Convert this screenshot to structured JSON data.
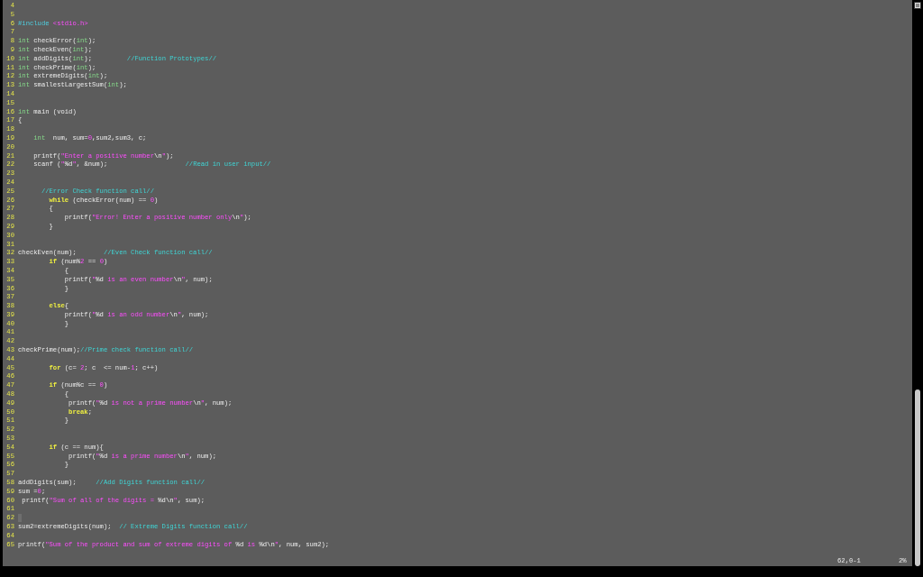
{
  "editor": {
    "lines": [
      {
        "number": "4"
      },
      {
        "number": "5"
      },
      {
        "number": "6",
        "tokens": [
          {
            "kind": "preproc",
            "text": "#include"
          },
          {
            "kind": "string",
            "text": " <stdio.h>"
          }
        ]
      },
      {
        "number": "7"
      },
      {
        "number": "8",
        "tokens": [
          {
            "kind": "type",
            "text": "int"
          },
          " checkError(",
          {
            "kind": "type",
            "text": "int"
          },
          ");"
        ]
      },
      {
        "number": "9",
        "tokens": [
          {
            "kind": "type",
            "text": "int"
          },
          " checkEven(",
          {
            "kind": "type",
            "text": "int"
          },
          ");"
        ]
      },
      {
        "number": "10",
        "tokens": [
          {
            "kind": "type",
            "text": "int"
          },
          " addDigits(",
          {
            "kind": "type",
            "text": "int"
          },
          ");         ",
          {
            "kind": "comment",
            "text": "//Function Prototypes//"
          }
        ]
      },
      {
        "number": "11",
        "tokens": [
          {
            "kind": "type",
            "text": "int"
          },
          " checkPrime(",
          {
            "kind": "type",
            "text": "int"
          },
          ");"
        ]
      },
      {
        "number": "12",
        "tokens": [
          {
            "kind": "type",
            "text": "int"
          },
          " extremeDigits(",
          {
            "kind": "type",
            "text": "int"
          },
          ");"
        ]
      },
      {
        "number": "13",
        "tokens": [
          {
            "kind": "type",
            "text": "int"
          },
          " smallestLargestSum(",
          {
            "kind": "type",
            "text": "int"
          },
          ");"
        ]
      },
      {
        "number": "14"
      },
      {
        "number": "15"
      },
      {
        "number": "16",
        "tokens": [
          {
            "kind": "type",
            "text": "int"
          },
          " main (void)"
        ]
      },
      {
        "number": "17",
        "tokens": [
          "{"
        ]
      },
      {
        "number": "18"
      },
      {
        "number": "19",
        "tokens": [
          {
            "kind": "type",
            "text": "    int"
          },
          "  num, sum=",
          {
            "kind": "number",
            "text": "0"
          },
          ",sum2,sum3, c;"
        ]
      },
      {
        "number": "20"
      },
      {
        "number": "21",
        "tokens": [
          "    printf(",
          {
            "kind": "string",
            "text": "\"Enter a positive number"
          },
          {
            "kind": "special",
            "text": "\\n"
          },
          {
            "kind": "string",
            "text": "\""
          },
          ");"
        ]
      },
      {
        "number": "22",
        "tokens": [
          "    scanf (",
          {
            "kind": "string",
            "text": "\""
          },
          {
            "kind": "special",
            "text": "%d"
          },
          {
            "kind": "string",
            "text": "\""
          },
          ", &num);                    ",
          {
            "kind": "comment",
            "text": "//Read in user input//"
          }
        ]
      },
      {
        "number": "23"
      },
      {
        "number": "24"
      },
      {
        "number": "25",
        "tokens": [
          {
            "kind": "comment",
            "text": "      //Error Check function call//"
          }
        ]
      },
      {
        "number": "26",
        "tokens": [
          {
            "kind": "keyword",
            "text": "        while"
          },
          " (checkError(num) == ",
          {
            "kind": "number",
            "text": "0"
          },
          ")"
        ]
      },
      {
        "number": "27",
        "tokens": [
          "        {"
        ]
      },
      {
        "number": "28",
        "tokens": [
          "            printf(",
          {
            "kind": "string",
            "text": "\"Error! Enter a positive number only"
          },
          {
            "kind": "special",
            "text": "\\n"
          },
          {
            "kind": "string",
            "text": "\""
          },
          ");"
        ]
      },
      {
        "number": "29",
        "tokens": [
          "        }"
        ]
      },
      {
        "number": "30"
      },
      {
        "number": "31"
      },
      {
        "number": "32",
        "tokens": [
          "checkEven(num);       ",
          {
            "kind": "comment",
            "text": "//Even Check function call//"
          }
        ]
      },
      {
        "number": "33",
        "tokens": [
          {
            "kind": "keyword",
            "text": "        if"
          },
          " (num%",
          {
            "kind": "number",
            "text": "2"
          },
          " == ",
          {
            "kind": "number",
            "text": "0"
          },
          ")"
        ]
      },
      {
        "number": "34",
        "tokens": [
          "            {"
        ]
      },
      {
        "number": "35",
        "tokens": [
          "            printf(",
          {
            "kind": "string",
            "text": "\""
          },
          {
            "kind": "special",
            "text": "%d"
          },
          {
            "kind": "string",
            "text": " is an even number"
          },
          {
            "kind": "special",
            "text": "\\n"
          },
          {
            "kind": "string",
            "text": "\""
          },
          ", num);"
        ]
      },
      {
        "number": "36",
        "tokens": [
          "            }"
        ]
      },
      {
        "number": "37"
      },
      {
        "number": "38",
        "tokens": [
          {
            "kind": "keyword",
            "text": "        else"
          },
          "{"
        ]
      },
      {
        "number": "39",
        "tokens": [
          "            printf(",
          {
            "kind": "string",
            "text": "\""
          },
          {
            "kind": "special",
            "text": "%d"
          },
          {
            "kind": "string",
            "text": " is an odd number"
          },
          {
            "kind": "special",
            "text": "\\n"
          },
          {
            "kind": "string",
            "text": "\""
          },
          ", num);"
        ]
      },
      {
        "number": "40",
        "tokens": [
          "            }"
        ]
      },
      {
        "number": "41"
      },
      {
        "number": "42"
      },
      {
        "number": "43",
        "tokens": [
          "checkPrime(num);",
          {
            "kind": "comment",
            "text": "//Prime check function call//"
          }
        ]
      },
      {
        "number": "44"
      },
      {
        "number": "45",
        "tokens": [
          {
            "kind": "keyword",
            "text": "        for"
          },
          " (c= ",
          {
            "kind": "number",
            "text": "2"
          },
          "; c  <= num-",
          {
            "kind": "number",
            "text": "1"
          },
          "; c++)"
        ]
      },
      {
        "number": "46"
      },
      {
        "number": "47",
        "tokens": [
          {
            "kind": "keyword",
            "text": "        if"
          },
          " (num%c == ",
          {
            "kind": "number",
            "text": "0"
          },
          ")"
        ]
      },
      {
        "number": "48",
        "tokens": [
          "            {"
        ]
      },
      {
        "number": "49",
        "tokens": [
          "             printf(",
          {
            "kind": "string",
            "text": "\""
          },
          {
            "kind": "special",
            "text": "%d"
          },
          {
            "kind": "string",
            "text": " is not a prime number"
          },
          {
            "kind": "special",
            "text": "\\n"
          },
          {
            "kind": "string",
            "text": "\""
          },
          ", num);"
        ]
      },
      {
        "number": "50",
        "tokens": [
          {
            "kind": "keyword",
            "text": "             break"
          },
          ";"
        ]
      },
      {
        "number": "51",
        "tokens": [
          "            }"
        ]
      },
      {
        "number": "52"
      },
      {
        "number": "53"
      },
      {
        "number": "54",
        "tokens": [
          {
            "kind": "keyword",
            "text": "        if"
          },
          " (c == num){"
        ]
      },
      {
        "number": "55",
        "tokens": [
          "             printf(",
          {
            "kind": "string",
            "text": "\""
          },
          {
            "kind": "special",
            "text": "%d"
          },
          {
            "kind": "string",
            "text": " is a prime number"
          },
          {
            "kind": "special",
            "text": "\\n"
          },
          {
            "kind": "string",
            "text": "\""
          },
          ", num);"
        ]
      },
      {
        "number": "56",
        "tokens": [
          "            }"
        ]
      },
      {
        "number": "57"
      },
      {
        "number": "58",
        "tokens": [
          "addDigits(sum);     ",
          {
            "kind": "comment",
            "text": "//Add Digits function call//"
          }
        ]
      },
      {
        "number": "59",
        "tokens": [
          "sum =",
          {
            "kind": "number",
            "text": "0"
          },
          ";"
        ]
      },
      {
        "number": "60",
        "tokens": [
          " printf(",
          {
            "kind": "string",
            "text": "\"Sum of all of the digits = "
          },
          {
            "kind": "special",
            "text": "%d\\n"
          },
          {
            "kind": "string",
            "text": "\""
          },
          ", sum);"
        ]
      },
      {
        "number": "61"
      },
      {
        "number": "62",
        "cursor": true
      },
      {
        "number": "63",
        "tokens": [
          "sum2=extremeDigits(num);  ",
          {
            "kind": "comment",
            "text": "// Extreme Digits function call//"
          }
        ]
      },
      {
        "number": "64"
      },
      {
        "number": "65",
        "tokens": [
          "printf(",
          {
            "kind": "string",
            "text": "\"Sum of the product and sum of extreme digits of "
          },
          {
            "kind": "special",
            "text": "%d"
          },
          {
            "kind": "string",
            "text": " is "
          },
          {
            "kind": "special",
            "text": "%d\\n"
          },
          {
            "kind": "string",
            "text": "\""
          },
          ", num, sum2);"
        ]
      }
    ]
  },
  "status_bar": {
    "position": "62,0-1",
    "percent": "2%"
  }
}
